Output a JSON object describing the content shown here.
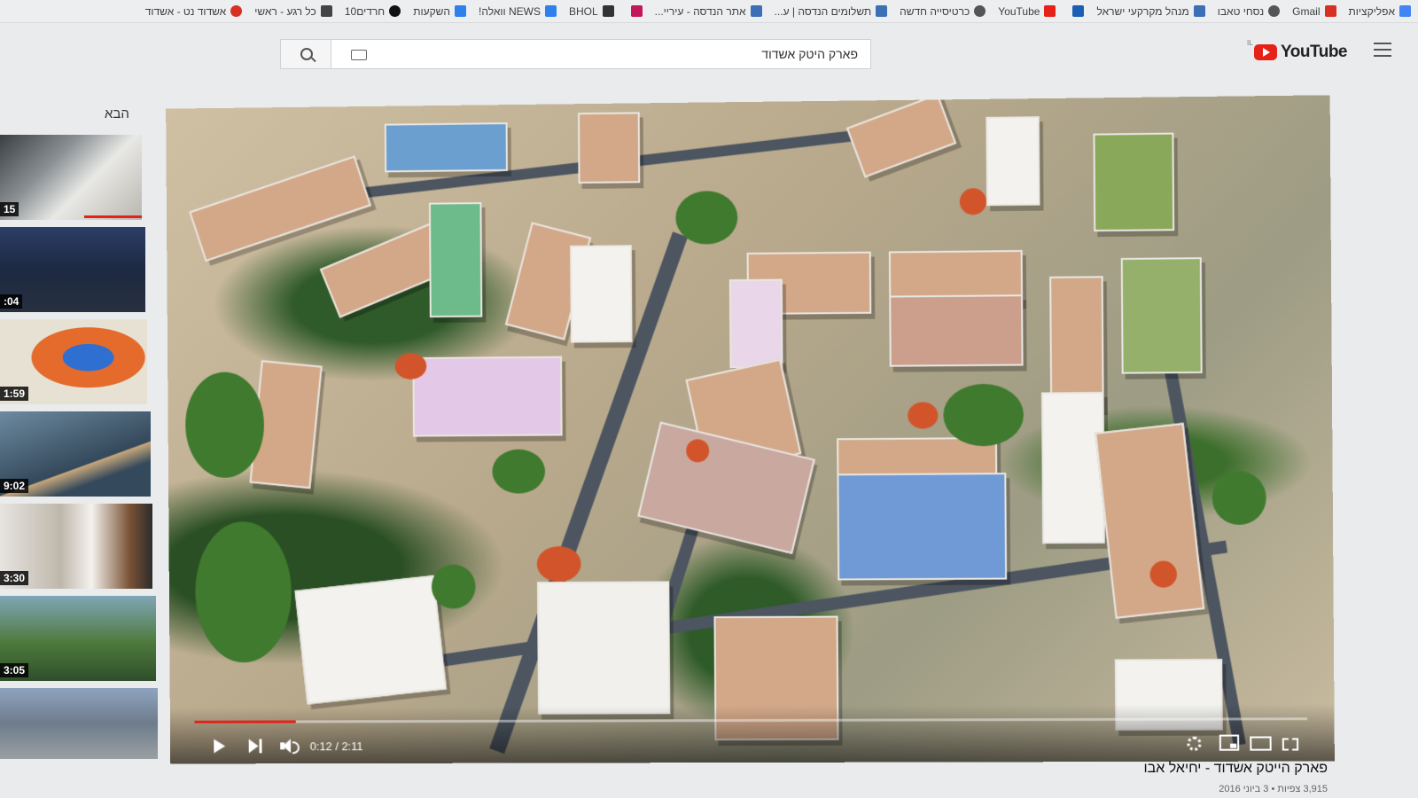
{
  "bookmarks": [
    {
      "label": "אפליקציות",
      "icon": "apps-icon",
      "color": "#4285f4"
    },
    {
      "label": "Gmail",
      "icon": "gmail-icon",
      "color": "#d93025"
    },
    {
      "label": "נסחי טאבו",
      "icon": "globe-icon",
      "color": "#555555"
    },
    {
      "label": "מנהל מקרקעי ישראל",
      "icon": "list-icon",
      "color": "#3b6fb6"
    },
    {
      "label": "",
      "icon": "checkmark-icon",
      "color": "#1a5fb4"
    },
    {
      "label": "YouTube",
      "icon": "youtube-icon",
      "color": "#e62117"
    },
    {
      "label": "כרטיסייה חדשה",
      "icon": "globe-icon",
      "color": "#555555"
    },
    {
      "label": "תשלומים הנדסה | ע...",
      "icon": "bookmark-icon",
      "color": "#3b6fb6"
    },
    {
      "label": "אתר הנדסה - עיריי...",
      "icon": "city-icon",
      "color": "#3b6fb6"
    },
    {
      "label": "",
      "icon": "app-icon",
      "color": "#c2185b"
    },
    {
      "label": "BHOL",
      "icon": "monitor-icon",
      "color": "#333333"
    },
    {
      "label": "NEWS וואלה!",
      "icon": "news-icon",
      "color": "#2f80ed"
    },
    {
      "label": "השקעות",
      "icon": "home-icon",
      "color": "#2f80ed"
    },
    {
      "label": "חרדים10",
      "icon": "news10-icon",
      "color": "#111111"
    },
    {
      "label": "כל רגע - ראשי",
      "icon": "media-icon",
      "color": "#444444"
    },
    {
      "label": "אשדוד נט - אשדוד",
      "icon": "heart-icon",
      "color": "#d93025"
    }
  ],
  "header": {
    "logo_text": "YouTube",
    "logo_country": "IL",
    "search_value": "פארק היטק אשדוד"
  },
  "sidebar": {
    "next_label": "הבא",
    "items": [
      {
        "duration": "15"
      },
      {
        "duration": ":04"
      },
      {
        "duration": "1:59"
      },
      {
        "duration": "9:02"
      },
      {
        "duration": "3:30"
      },
      {
        "duration": "3:05"
      },
      {
        "duration": ""
      }
    ]
  },
  "player": {
    "time": "0:12 / 2:11",
    "progress": 0.092
  },
  "video": {
    "title": "פארק הייטק אשדוד - יחיאל אבו",
    "meta": "3,915 צפיות • 3 ביוני 2016"
  },
  "colors": {
    "accent": "#e62117"
  }
}
